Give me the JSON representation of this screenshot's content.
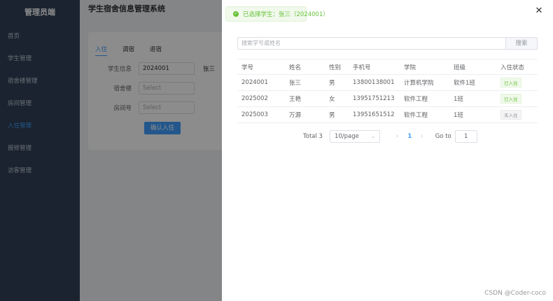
{
  "sidebar": {
    "brand": "管理员端",
    "items": [
      {
        "label": "首页"
      },
      {
        "label": "学生管理"
      },
      {
        "label": "宿舍楼管理"
      },
      {
        "label": "房间管理"
      },
      {
        "label": "入住管理"
      },
      {
        "label": "报修管理"
      },
      {
        "label": "访客管理"
      }
    ]
  },
  "main": {
    "title": "学生宿舍信息管理系统",
    "tabs": [
      {
        "label": "入住"
      },
      {
        "label": "调宿"
      },
      {
        "label": "退宿"
      }
    ],
    "form": {
      "student_label": "学生信息",
      "student_value": "2024001",
      "student_name": "张三",
      "building_label": "宿舍楼",
      "building_placeholder": "Select",
      "room_label": "房间号",
      "room_placeholder": "Select",
      "confirm_label": "确认入住"
    }
  },
  "toast": {
    "message": "已选择学生：张三（2024001）"
  },
  "drawer": {
    "search_placeholder": "搜索学号或姓名",
    "search_button": "搜索",
    "columns": [
      "学号",
      "姓名",
      "性别",
      "手机号",
      "学院",
      "班级",
      "入住状态"
    ],
    "rows": [
      {
        "id": "2024001",
        "name": "张三",
        "gender": "男",
        "phone": "13800138001",
        "college": "计算机学院",
        "class": "软件1班",
        "status": "已入住"
      },
      {
        "id": "2025002",
        "name": "王艳",
        "gender": "女",
        "phone": "13951751213",
        "college": "软件工程",
        "class": "1班",
        "status": "已入住"
      },
      {
        "id": "2025003",
        "name": "万源",
        "gender": "男",
        "phone": "13951651512",
        "college": "软件工程",
        "class": "1班",
        "status": "未入住"
      }
    ],
    "pager": {
      "total": "Total 3",
      "page_size": "10/page",
      "current_page": "1",
      "goto_label": "Go to",
      "goto_value": "1"
    }
  },
  "watermark": "CSDN @Coder-coco"
}
